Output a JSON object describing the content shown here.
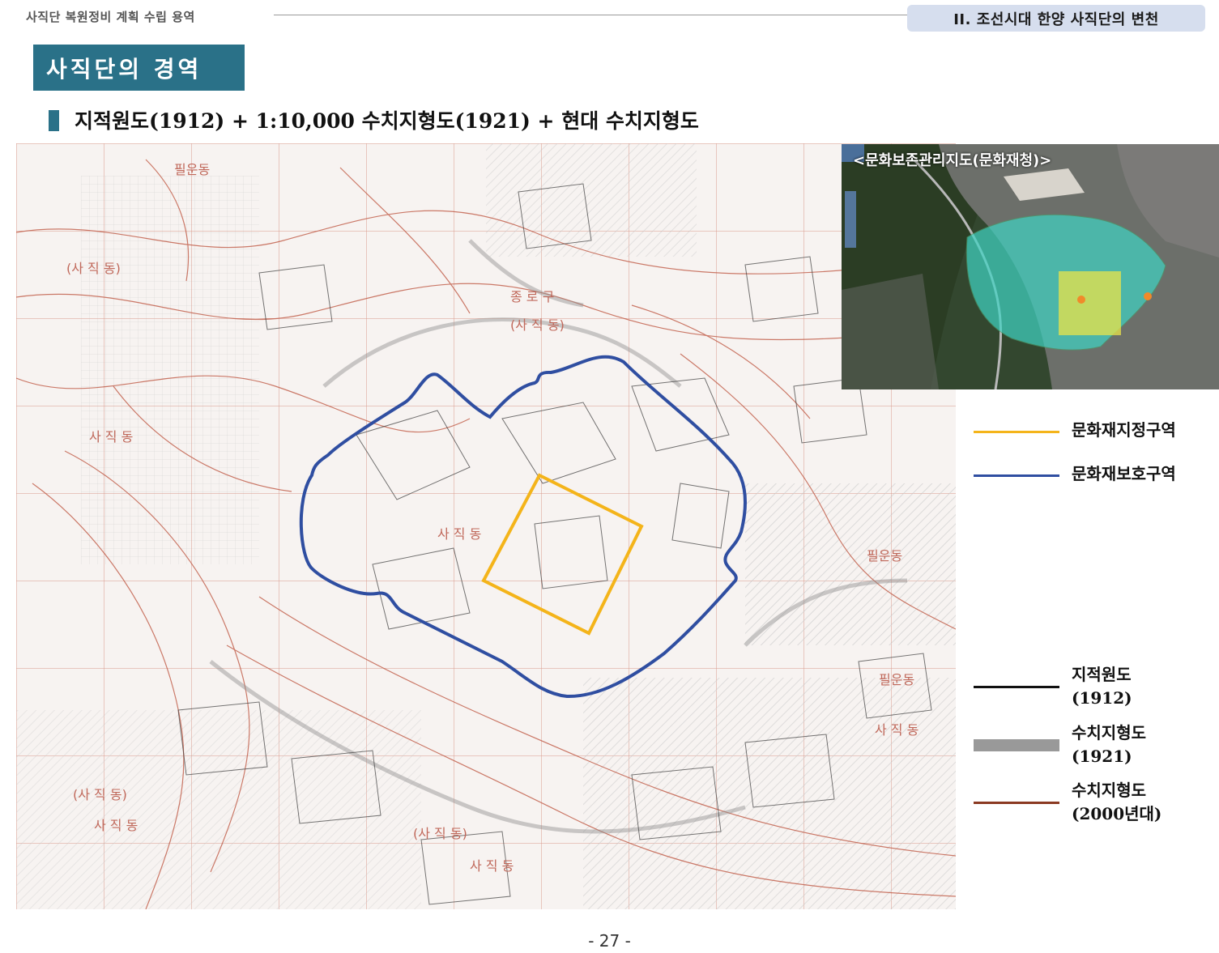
{
  "header": {
    "doc_title": "사직단 복원정비 계획 수립 용역",
    "chapter": "II. 조선시대 한양 사직단의 변천"
  },
  "section": {
    "title": "사직단의 경역",
    "subheading": "지적원도(1912) + 1:10,000 수치지형도(1921) + 현대 수치지형도"
  },
  "map": {
    "place_labels": [
      "필운동",
      "(사 직 동)",
      "종 로 구",
      "(사 직 동)",
      "사 직 동",
      "사 직 동",
      "필운동",
      "필운동",
      "사 직 동",
      "(사 직 동)",
      "사 직 동",
      "(사 직 동)",
      "사 직 동"
    ]
  },
  "inset": {
    "title": "<문화보존관리지도(문화재청)>"
  },
  "legend": {
    "items": [
      {
        "label": "문화재지정구역",
        "color": "#f4b41a"
      },
      {
        "label": "문화재보호구역",
        "color": "#2f4ea1"
      },
      {
        "label_line1": "지적원도",
        "label_line2": "(1912)",
        "color": "#111111"
      },
      {
        "label_line1": "수치지형도",
        "label_line2": "(1921)",
        "color": "#999999"
      },
      {
        "label_line1": "수치지형도",
        "label_line2": "(2000년대)",
        "color": "#8b3a22"
      }
    ]
  },
  "footer": {
    "page": "- 27 -"
  }
}
